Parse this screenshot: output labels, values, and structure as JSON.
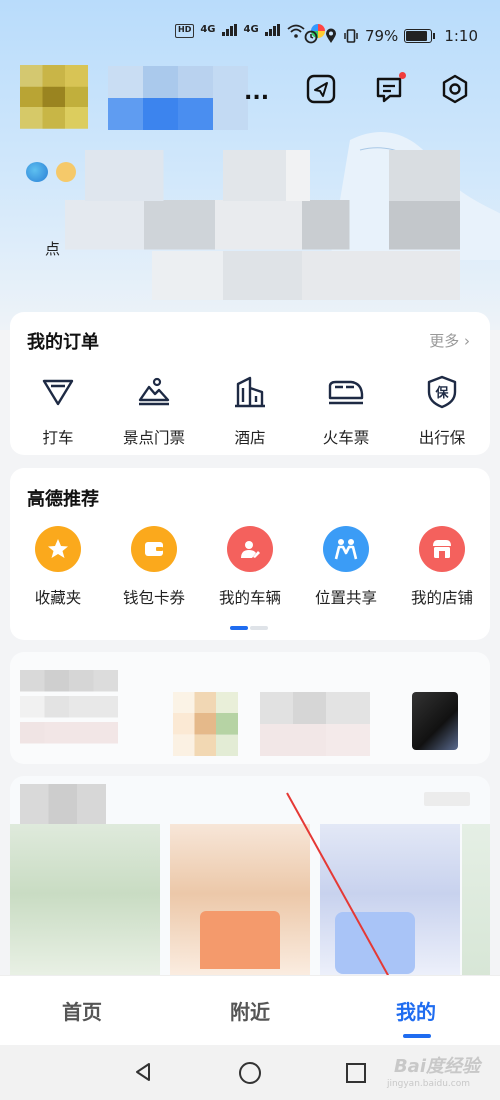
{
  "status_bar": {
    "battery": "79%",
    "time": "1:10",
    "net1": "4G",
    "net2": "4G",
    "hd": "HD"
  },
  "header": {
    "partial_char": "点",
    "truncated_name_suffix": "..."
  },
  "orders": {
    "title": "我的订单",
    "more": "更多",
    "items": [
      {
        "label": "打车",
        "icon": "taxi-icon"
      },
      {
        "label": "景点门票",
        "icon": "scenic-ticket-icon"
      },
      {
        "label": "酒店",
        "icon": "hotel-icon"
      },
      {
        "label": "火车票",
        "icon": "train-icon"
      },
      {
        "label": "出行保",
        "icon": "insurance-icon"
      }
    ]
  },
  "recommend": {
    "title": "高德推荐",
    "items": [
      {
        "label": "收藏夹",
        "icon": "star-icon",
        "color": "#fba91c"
      },
      {
        "label": "钱包卡券",
        "icon": "wallet-icon",
        "color": "#fba91c"
      },
      {
        "label": "我的车辆",
        "icon": "car-user-icon",
        "color": "#f4615d"
      },
      {
        "label": "位置共享",
        "icon": "people-icon",
        "color": "#3b9cf6"
      },
      {
        "label": "我的店铺",
        "icon": "shop-icon",
        "color": "#f4615d"
      }
    ]
  },
  "bottom_nav": {
    "tabs": [
      {
        "label": "首页",
        "active": false
      },
      {
        "label": "附近",
        "active": false
      },
      {
        "label": "我的",
        "active": true
      }
    ]
  },
  "watermark": {
    "text": "Bai度经验",
    "sub": "jingyan.baidu.com"
  },
  "colors": {
    "accent": "#1f6cf0",
    "annotation_arrow": "#e53935"
  }
}
